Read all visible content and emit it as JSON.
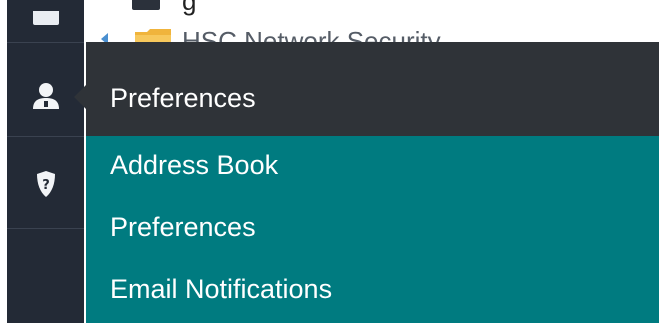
{
  "sidebar": {
    "icons": [
      "folder-icon",
      "user-icon",
      "help-shield-icon"
    ]
  },
  "tree": {
    "top_label_partial": "g",
    "node_label": "HSC Network Security"
  },
  "popup": {
    "header": "Preferences",
    "items": [
      {
        "label": "Address Book"
      },
      {
        "label": "Preferences"
      },
      {
        "label": "Email Notifications"
      }
    ]
  },
  "colors": {
    "rail": "#232a36",
    "popup_header": "#2f3338",
    "popup_list": "#007b80",
    "text_on_dark": "#ffffff"
  }
}
